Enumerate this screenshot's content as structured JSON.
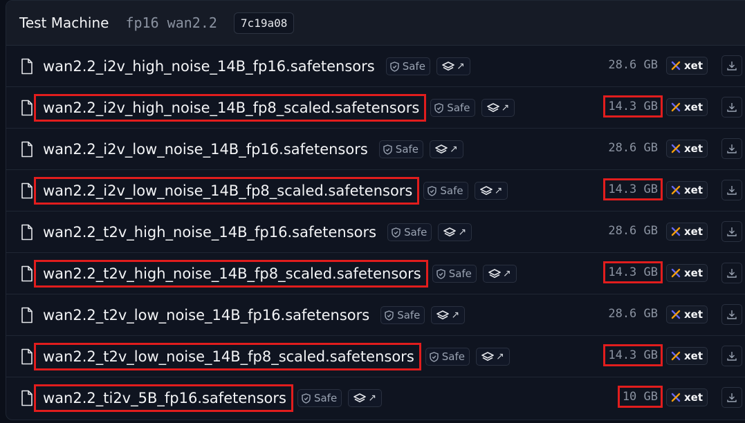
{
  "header": {
    "title": "Test Machine",
    "tags": "fp16 wan2.2",
    "commit": "7c19a08"
  },
  "badges": {
    "safe": "Safe",
    "xet": "xet",
    "stack_arrow": "↗"
  },
  "files": [
    {
      "name": "wan2.2_i2v_high_noise_14B_fp16.safetensors",
      "size": "28.6 GB",
      "highlighted": false
    },
    {
      "name": "wan2.2_i2v_high_noise_14B_fp8_scaled.safetensors",
      "size": "14.3 GB",
      "highlighted": true
    },
    {
      "name": "wan2.2_i2v_low_noise_14B_fp16.safetensors",
      "size": "28.6 GB",
      "highlighted": false
    },
    {
      "name": "wan2.2_i2v_low_noise_14B_fp8_scaled.safetensors",
      "size": "14.3 GB",
      "highlighted": true
    },
    {
      "name": "wan2.2_t2v_high_noise_14B_fp16.safetensors",
      "size": "28.6 GB",
      "highlighted": false
    },
    {
      "name": "wan2.2_t2v_high_noise_14B_fp8_scaled.safetensors",
      "size": "14.3 GB",
      "highlighted": true
    },
    {
      "name": "wan2.2_t2v_low_noise_14B_fp16.safetensors",
      "size": "28.6 GB",
      "highlighted": false
    },
    {
      "name": "wan2.2_t2v_low_noise_14B_fp8_scaled.safetensors",
      "size": "14.3 GB",
      "highlighted": true
    },
    {
      "name": "wan2.2_ti2v_5B_fp16.safetensors",
      "size": "10 GB",
      "highlighted": true
    }
  ],
  "colors": {
    "highlight": "#e11d1d",
    "xet_accent_orange": "#f59e0b",
    "xet_accent_blue": "#6366f1"
  }
}
